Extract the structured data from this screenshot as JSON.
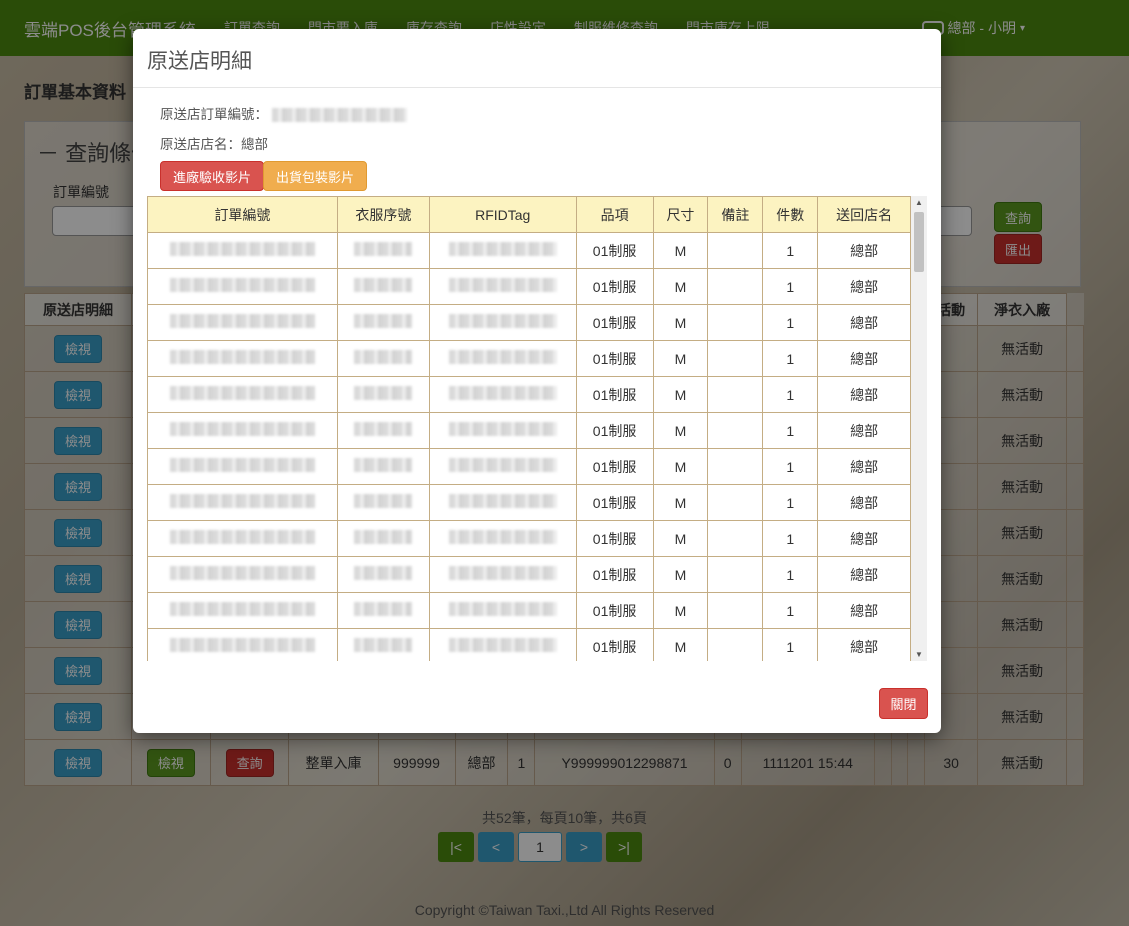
{
  "navbar": {
    "brand": "雲端POS後台管理系統",
    "items": [
      "訂單查詢",
      "門市要入庫",
      "庫存查詢",
      "店性設定",
      "制服維修查詢",
      "門市庫存上限"
    ],
    "user": "總部 - 小明",
    "user_caret": "▾"
  },
  "page": {
    "title": "訂單基本資料",
    "query_panel_title": "－ 查詢條件",
    "field_label": "訂單編號",
    "query_button": "查詢",
    "export_button": "匯出"
  },
  "bg_table": {
    "headers": [
      "原送店明細",
      "",
      "",
      "",
      "",
      "",
      "",
      "",
      "",
      "",
      "",
      "",
      "",
      "活動",
      "淨衣入廠"
    ],
    "row_button": "檢視",
    "row_button2": "檢視",
    "row_query": "查詢",
    "activity": "無活動",
    "last_row": {
      "type": "整單入庫",
      "code": "999999",
      "store": "總部",
      "qty": "1",
      "order": "Y999999012298871",
      "zero": "0",
      "datetime": "1111201 15:44",
      "num": "30",
      "activity": "無活動"
    }
  },
  "pager": {
    "summary": "共52筆，每頁10筆，共6頁",
    "first": "|<",
    "prev": "<",
    "current": "1",
    "next": ">",
    "last": ">|"
  },
  "footer": "Copyright ©Taiwan Taxi.,Ltd All Rights Reserved",
  "modal": {
    "title": "原送店明細",
    "order_no_label": "原送店訂單編號：",
    "store_name_label": "原送店店名：總部",
    "receive_video_button": "進廠驗收影片",
    "ship_video_button": "出貨包裝影片",
    "close_button": "關閉",
    "table": {
      "headers": [
        "訂單編號",
        "衣服序號",
        "RFIDTag",
        "品項",
        "尺寸",
        "備註",
        "件數",
        "送回店名"
      ],
      "rows": [
        {
          "item": "01制服",
          "size": "M",
          "note": "",
          "qty": "1",
          "store": "總部"
        },
        {
          "item": "01制服",
          "size": "M",
          "note": "",
          "qty": "1",
          "store": "總部"
        },
        {
          "item": "01制服",
          "size": "M",
          "note": "",
          "qty": "1",
          "store": "總部"
        },
        {
          "item": "01制服",
          "size": "M",
          "note": "",
          "qty": "1",
          "store": "總部"
        },
        {
          "item": "01制服",
          "size": "M",
          "note": "",
          "qty": "1",
          "store": "總部"
        },
        {
          "item": "01制服",
          "size": "M",
          "note": "",
          "qty": "1",
          "store": "總部"
        },
        {
          "item": "01制服",
          "size": "M",
          "note": "",
          "qty": "1",
          "store": "總部"
        },
        {
          "item": "01制服",
          "size": "M",
          "note": "",
          "qty": "1",
          "store": "總部"
        },
        {
          "item": "01制服",
          "size": "M",
          "note": "",
          "qty": "1",
          "store": "總部"
        },
        {
          "item": "01制服",
          "size": "M",
          "note": "",
          "qty": "1",
          "store": "總部"
        },
        {
          "item": "01制服",
          "size": "M",
          "note": "",
          "qty": "1",
          "store": "總部"
        },
        {
          "item": "01制服",
          "size": "M",
          "note": "",
          "qty": "1",
          "store": "總部"
        }
      ]
    }
  }
}
